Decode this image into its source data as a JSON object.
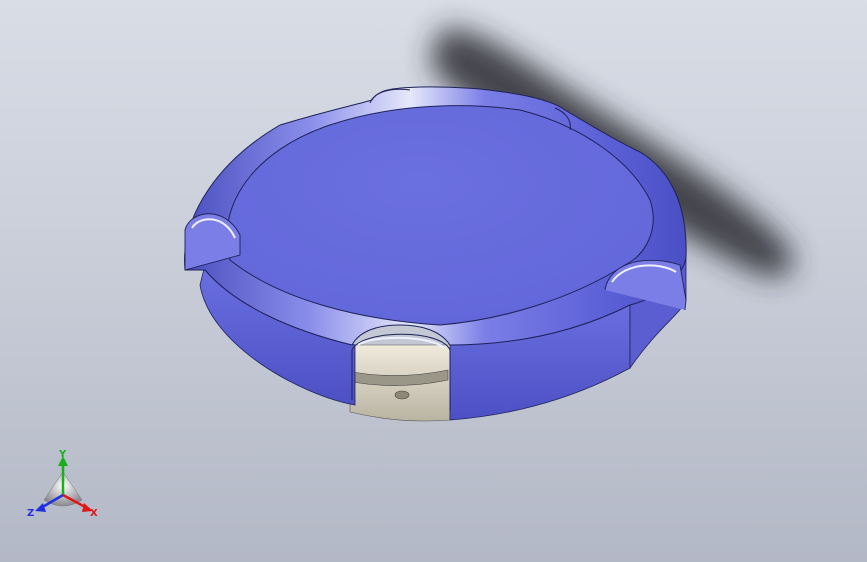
{
  "viewport": {
    "background_top": "#d9dde6",
    "background_bottom": "#b3b8c6"
  },
  "model": {
    "body_color": "#6a70e0",
    "rim_highlight": "#e8eafc",
    "inner_part_color": "#d8d2c0",
    "shadow_color": "#2a2c30"
  },
  "triad": {
    "x_label": "X",
    "y_label": "Y",
    "z_label": "Z",
    "x_color": "#e01818",
    "y_color": "#18b018",
    "z_color": "#2030e0"
  }
}
